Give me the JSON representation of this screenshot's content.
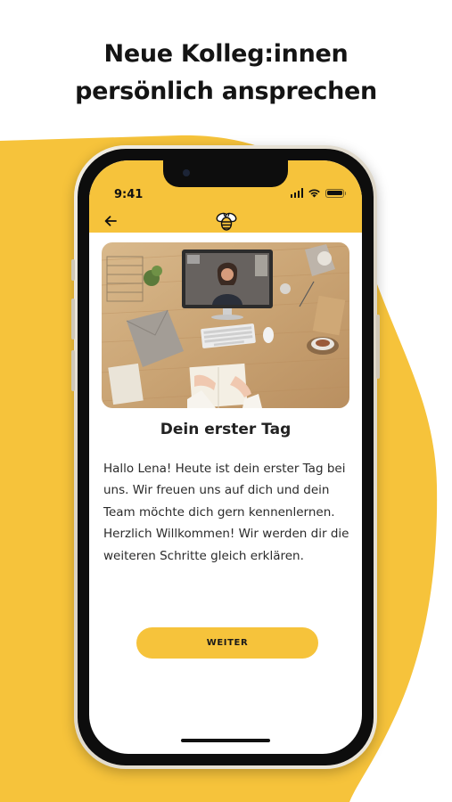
{
  "promo": {
    "headline_line1": "Neue Kolleg:innen",
    "headline_line2": "persönlich ansprechen",
    "accent_color": "#f6c33b"
  },
  "status_bar": {
    "time": "9:41",
    "icons": [
      "cellular-signal-icon",
      "wifi-icon",
      "battery-icon"
    ]
  },
  "app_header": {
    "back_icon": "arrow-left-icon",
    "logo_icon": "bee-logo-icon",
    "background_color": "#f6c33b"
  },
  "content": {
    "image_description_icon": "video-call-desk-photo",
    "title": "Dein erster Tag",
    "paragraph1": "Hallo Lena! Heute ist dein erster Tag bei uns. Wir freuen uns auf dich und dein Team möchte dich gern kennenlernen.",
    "paragraph2": "Herzlich Willkommen! Wir werden dir die weiteren Schritte gleich erklären.",
    "button_label": "WEITER"
  }
}
